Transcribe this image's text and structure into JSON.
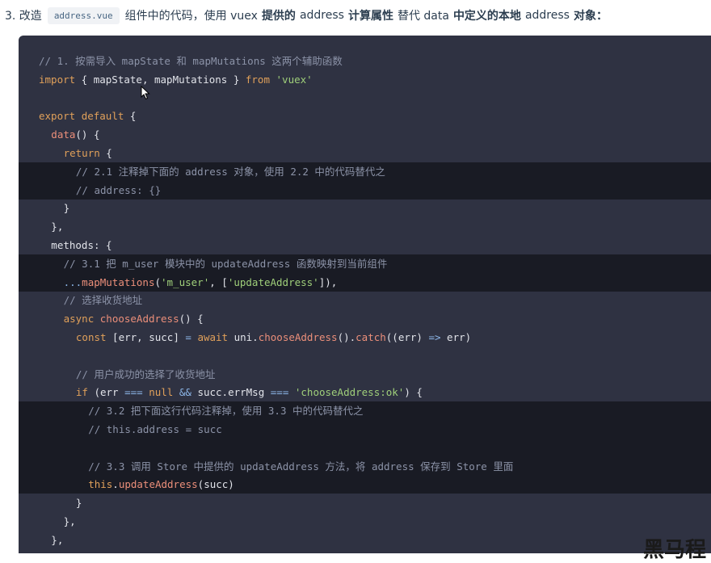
{
  "header": {
    "prefix": "3. 改造",
    "inline_code": "address.vue",
    "part1": "组件中的代码，使用 vuex",
    "bold1": "提供的",
    "part2": "address",
    "bold2": "计算属性",
    "part3": "替代 data",
    "bold3": "中定义的本地",
    "part4": "address",
    "bold4": "对象："
  },
  "code_lines": [
    {
      "hl": false,
      "indent": 1,
      "tokens": [
        {
          "c": "c",
          "t": "// 1. 按需导入 mapState 和 mapMutations 这两个辅助函数"
        }
      ]
    },
    {
      "hl": false,
      "indent": 1,
      "tokens": [
        {
          "c": "k",
          "t": "import"
        },
        {
          "c": "p",
          "t": " { mapState, mapMutations } "
        },
        {
          "c": "k",
          "t": "from"
        },
        {
          "c": "p",
          "t": " "
        },
        {
          "c": "s",
          "t": "'vuex'"
        }
      ]
    },
    {
      "hl": false,
      "indent": 0,
      "tokens": []
    },
    {
      "hl": false,
      "indent": 1,
      "tokens": [
        {
          "c": "k",
          "t": "export"
        },
        {
          "c": "p",
          "t": " "
        },
        {
          "c": "k",
          "t": "default"
        },
        {
          "c": "p",
          "t": " {"
        }
      ]
    },
    {
      "hl": false,
      "indent": 2,
      "tokens": [
        {
          "c": "f",
          "t": "data"
        },
        {
          "c": "p",
          "t": "() {"
        }
      ]
    },
    {
      "hl": false,
      "indent": 3,
      "tokens": [
        {
          "c": "k",
          "t": "return"
        },
        {
          "c": "p",
          "t": " {"
        }
      ]
    },
    {
      "hl": true,
      "indent": 4,
      "tokens": [
        {
          "c": "c",
          "t": "// 2.1 注释掉下面的 address 对象，使用 2.2 中的代码替代之"
        }
      ]
    },
    {
      "hl": true,
      "indent": 4,
      "tokens": [
        {
          "c": "c",
          "t": "// address: {}"
        }
      ]
    },
    {
      "hl": false,
      "indent": 3,
      "tokens": [
        {
          "c": "p",
          "t": "}"
        }
      ]
    },
    {
      "hl": false,
      "indent": 2,
      "tokens": [
        {
          "c": "p",
          "t": "},"
        }
      ]
    },
    {
      "hl": false,
      "indent": 2,
      "tokens": [
        {
          "c": "p",
          "t": "methods: {"
        }
      ]
    },
    {
      "hl": true,
      "indent": 3,
      "tokens": [
        {
          "c": "c",
          "t": "// 3.1 把 m_user 模块中的 updateAddress 函数映射到当前组件"
        }
      ]
    },
    {
      "hl": true,
      "indent": 3,
      "tokens": [
        {
          "c": "o",
          "t": "..."
        },
        {
          "c": "f",
          "t": "mapMutations"
        },
        {
          "c": "p",
          "t": "("
        },
        {
          "c": "s",
          "t": "'m_user'"
        },
        {
          "c": "p",
          "t": ", ["
        },
        {
          "c": "s",
          "t": "'updateAddress'"
        },
        {
          "c": "p",
          "t": "]),"
        }
      ]
    },
    {
      "hl": false,
      "indent": 3,
      "tokens": [
        {
          "c": "c",
          "t": "// 选择收货地址"
        }
      ]
    },
    {
      "hl": false,
      "indent": 3,
      "tokens": [
        {
          "c": "k",
          "t": "async"
        },
        {
          "c": "p",
          "t": " "
        },
        {
          "c": "f",
          "t": "chooseAddress"
        },
        {
          "c": "p",
          "t": "() {"
        }
      ]
    },
    {
      "hl": false,
      "indent": 4,
      "tokens": [
        {
          "c": "k",
          "t": "const"
        },
        {
          "c": "p",
          "t": " [err, succ] "
        },
        {
          "c": "o",
          "t": "="
        },
        {
          "c": "p",
          "t": " "
        },
        {
          "c": "k",
          "t": "await"
        },
        {
          "c": "p",
          "t": " uni."
        },
        {
          "c": "f",
          "t": "chooseAddress"
        },
        {
          "c": "p",
          "t": "()."
        },
        {
          "c": "f",
          "t": "catch"
        },
        {
          "c": "p",
          "t": "((err) "
        },
        {
          "c": "o",
          "t": "=>"
        },
        {
          "c": "p",
          "t": " err)"
        }
      ]
    },
    {
      "hl": false,
      "indent": 0,
      "tokens": []
    },
    {
      "hl": false,
      "indent": 4,
      "tokens": [
        {
          "c": "c",
          "t": "// 用户成功的选择了收货地址"
        }
      ]
    },
    {
      "hl": false,
      "indent": 4,
      "tokens": [
        {
          "c": "k",
          "t": "if"
        },
        {
          "c": "p",
          "t": " (err "
        },
        {
          "c": "o",
          "t": "==="
        },
        {
          "c": "p",
          "t": " "
        },
        {
          "c": "k",
          "t": "null"
        },
        {
          "c": "p",
          "t": " "
        },
        {
          "c": "o",
          "t": "&&"
        },
        {
          "c": "p",
          "t": " succ.errMsg "
        },
        {
          "c": "o",
          "t": "==="
        },
        {
          "c": "p",
          "t": " "
        },
        {
          "c": "s",
          "t": "'chooseAddress:ok'"
        },
        {
          "c": "p",
          "t": ") {"
        }
      ]
    },
    {
      "hl": true,
      "indent": 5,
      "tokens": [
        {
          "c": "c",
          "t": "// 3.2 把下面这行代码注释掉，使用 3.3 中的代码替代之"
        }
      ]
    },
    {
      "hl": true,
      "indent": 5,
      "tokens": [
        {
          "c": "c",
          "t": "// this.address = succ"
        }
      ]
    },
    {
      "hl": true,
      "indent": 0,
      "tokens": []
    },
    {
      "hl": true,
      "indent": 5,
      "tokens": [
        {
          "c": "c",
          "t": "// 3.3 调用 Store 中提供的 updateAddress 方法，将 address 保存到 Store 里面"
        }
      ]
    },
    {
      "hl": true,
      "indent": 5,
      "tokens": [
        {
          "c": "k",
          "t": "this"
        },
        {
          "c": "p",
          "t": "."
        },
        {
          "c": "f",
          "t": "updateAddress"
        },
        {
          "c": "p",
          "t": "(succ)"
        }
      ]
    },
    {
      "hl": false,
      "indent": 4,
      "tokens": [
        {
          "c": "p",
          "t": "}"
        }
      ]
    },
    {
      "hl": false,
      "indent": 3,
      "tokens": [
        {
          "c": "p",
          "t": "},"
        }
      ]
    },
    {
      "hl": false,
      "indent": 2,
      "tokens": [
        {
          "c": "p",
          "t": "},"
        }
      ]
    }
  ],
  "watermark": "黑马程",
  "colors": {
    "code_bg": "#2f3242",
    "highlight_bg": "#191b24",
    "comment": "#8c93a8",
    "keyword": "#e0a05a",
    "function": "#ec8f7a",
    "string": "#9fcf7a",
    "operator": "#8cb6e8"
  },
  "icons": {
    "cursor": "mouse-pointer-icon"
  }
}
